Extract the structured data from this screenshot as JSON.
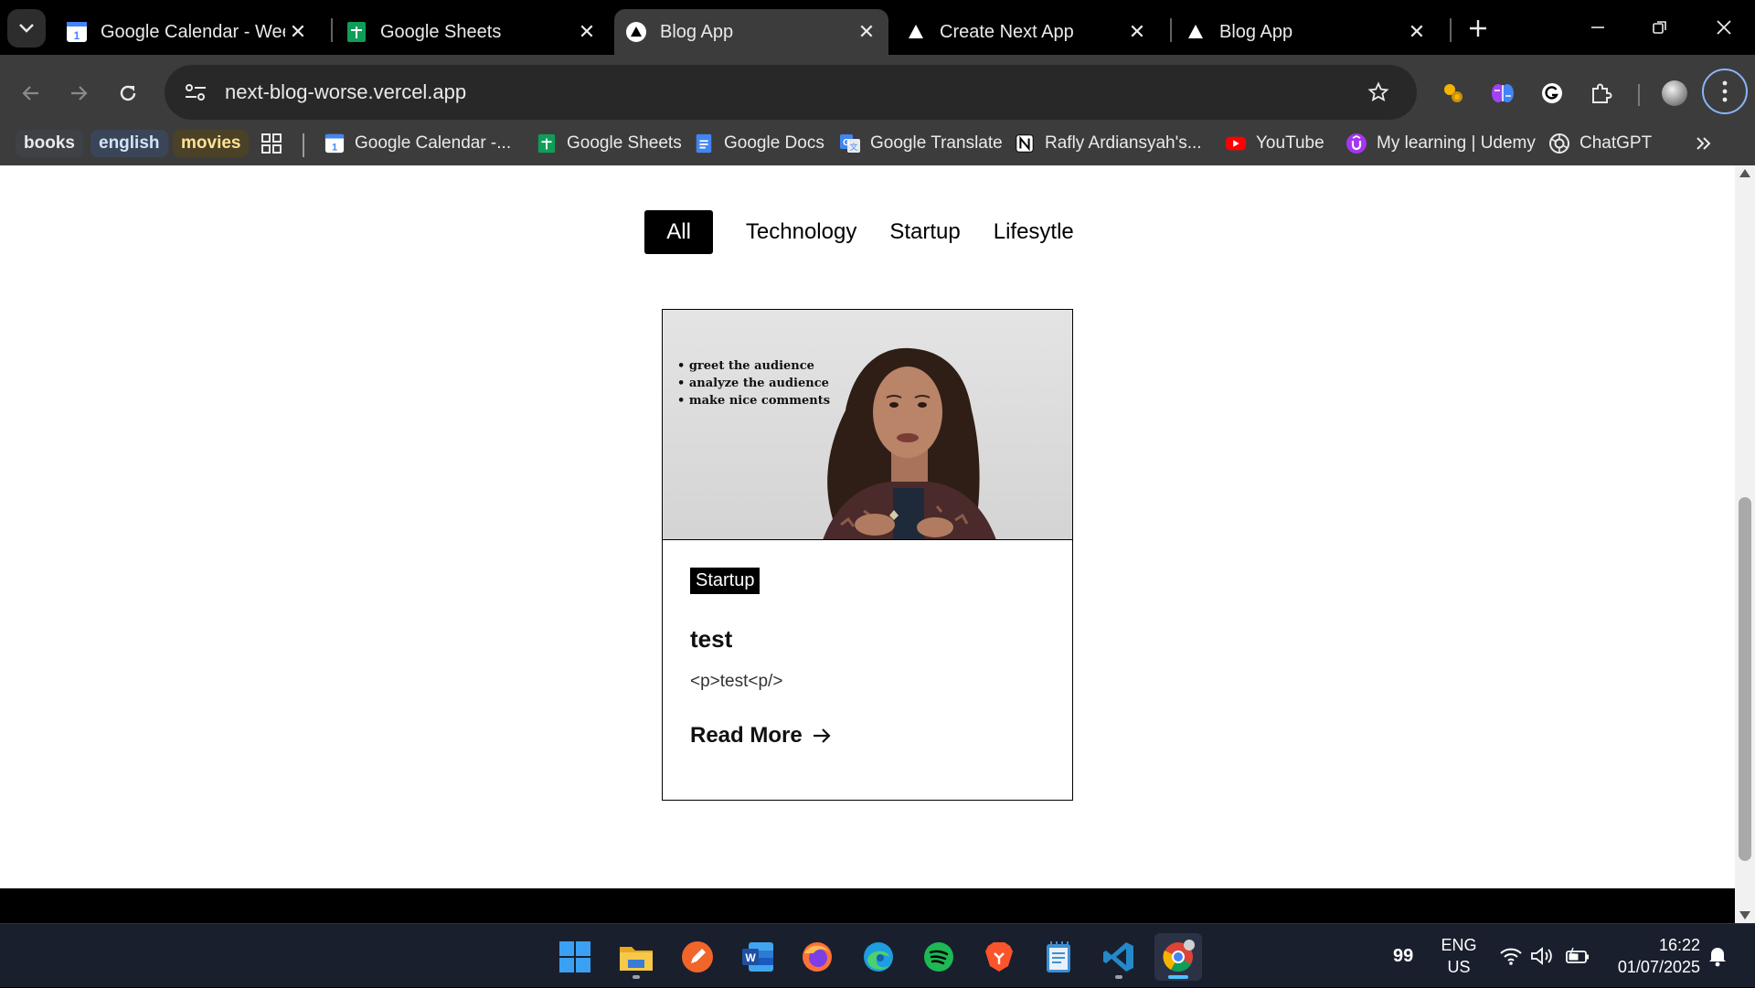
{
  "browser": {
    "tabs": [
      {
        "title": "Google Calendar - Week",
        "icon": "google-calendar-icon",
        "active": false
      },
      {
        "title": "Google Sheets",
        "icon": "google-sheets-icon",
        "active": false
      },
      {
        "title": "Blog App",
        "icon": "vercel-triangle-icon",
        "active": true
      },
      {
        "title": "Create Next App",
        "icon": "vercel-triangle-icon",
        "active": false
      },
      {
        "title": "Blog App",
        "icon": "vercel-triangle-icon",
        "active": false
      }
    ],
    "url": "next-blog-worse.vercel.app",
    "bookmark_groups": [
      {
        "label": "books",
        "bg": "#3f4147",
        "color": "#e8eaed"
      },
      {
        "label": "english",
        "bg": "#3a4658",
        "color": "#d2e3fc"
      },
      {
        "label": "movies",
        "bg": "#4a4127",
        "color": "#fde293"
      }
    ],
    "bookmarks": [
      {
        "label": "Google Calendar -...",
        "icon": "google-calendar-icon"
      },
      {
        "label": "Google Sheets",
        "icon": "google-sheets-icon"
      },
      {
        "label": "Google Docs",
        "icon": "google-docs-icon"
      },
      {
        "label": "Google Translate",
        "icon": "google-translate-icon"
      },
      {
        "label": "Rafly Ardiansyah's...",
        "icon": "notion-icon"
      },
      {
        "label": "YouTube",
        "icon": "youtube-icon"
      },
      {
        "label": "My learning | Udemy",
        "icon": "udemy-icon"
      },
      {
        "label": "ChatGPT",
        "icon": "chatgpt-icon"
      }
    ]
  },
  "page": {
    "filters": [
      {
        "label": "All",
        "active": true
      },
      {
        "label": "Technology",
        "active": false
      },
      {
        "label": "Startup",
        "active": false
      },
      {
        "label": "Lifesytle",
        "active": false
      }
    ],
    "card": {
      "image_bullets": [
        "greet the audience",
        "analyze the audience",
        "make nice comments"
      ],
      "category": "Startup",
      "title": "test",
      "excerpt": "<p>test<p/>",
      "read_more": "Read More"
    }
  },
  "taskbar": {
    "apps": [
      "windows-start-icon",
      "file-explorer-icon",
      "pen-app-icon",
      "word-icon",
      "firefox-icon",
      "edge-icon",
      "spotify-icon",
      "brave-icon",
      "notepad-icon",
      "vscode-icon",
      "chrome-icon"
    ],
    "badge": "99",
    "language": "ENG",
    "region": "US",
    "time": "16:22",
    "date": "01/07/2025"
  },
  "colors": {
    "accent": "#8ab4f8",
    "taskbar_highlight": "#4cc2ff"
  }
}
